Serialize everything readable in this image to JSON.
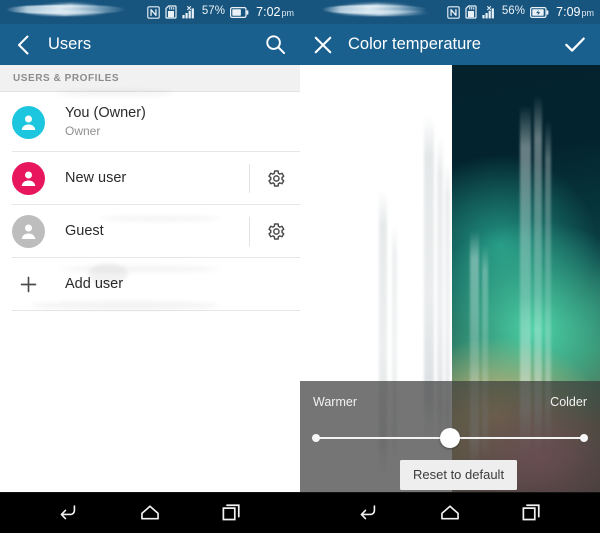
{
  "left_phone": {
    "status_bar": {
      "nfc_icon": "nfc-n-icon",
      "sdcard_icon": "sd-card-icon",
      "signal_icon": "signal-bars-no-service-icon",
      "battery_percent": "57%",
      "battery_icon": "battery-icon",
      "time": "7:02",
      "meridiem": "pm"
    },
    "app_bar": {
      "back_icon": "back-chevron-icon",
      "title": "Users",
      "search_icon": "search-icon"
    },
    "section_header": "USERS & PROFILES",
    "users": [
      {
        "name": "You (Owner)",
        "subtitle": "Owner",
        "avatar_color": "#1cc6de",
        "has_settings": false
      },
      {
        "name": "New user",
        "subtitle": "",
        "avatar_color": "#e8175d",
        "has_settings": true
      },
      {
        "name": "Guest",
        "subtitle": "",
        "avatar_color": "#bdbdbd",
        "has_settings": true
      }
    ],
    "add_user": {
      "label": "Add user",
      "icon": "plus-icon"
    },
    "nav": {
      "back": "back-icon",
      "home": "home-icon",
      "recents": "recents-icon"
    }
  },
  "right_phone": {
    "status_bar": {
      "nfc_icon": "nfc-n-icon",
      "sdcard_icon": "sd-card-icon",
      "signal_icon": "signal-bars-no-service-icon",
      "battery_percent": "56%",
      "battery_icon": "battery-charging-icon",
      "time": "7:09",
      "meridiem": "pm"
    },
    "app_bar": {
      "close_icon": "close-x-icon",
      "title": "Color temperature",
      "confirm_icon": "checkmark-icon"
    },
    "slider": {
      "left_label": "Warmer",
      "right_label": "Colder",
      "value_percent": 50
    },
    "reset_button": "Reset to default",
    "nav": {
      "back": "back-icon",
      "home": "home-icon",
      "recents": "recents-icon"
    }
  },
  "theme": {
    "status_bar_color": "#17547e",
    "app_bar_color": "#19608f",
    "accent_cyan": "#1cc6de",
    "accent_pink": "#e8175d",
    "nav_bar_color": "#000000"
  }
}
